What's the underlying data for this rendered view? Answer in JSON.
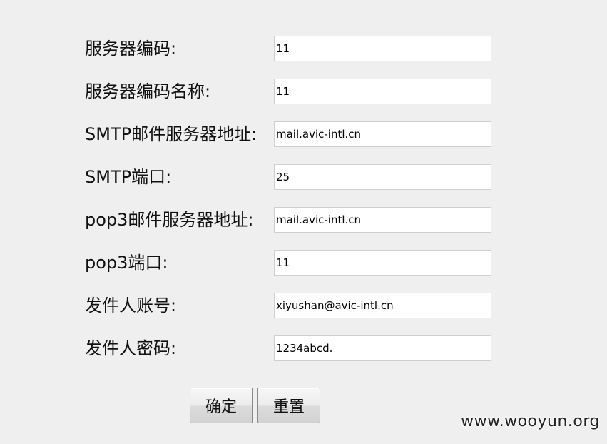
{
  "form": {
    "fields": [
      {
        "label": "服务器编码:",
        "value": "11"
      },
      {
        "label": "服务器编码名称:",
        "value": "11"
      },
      {
        "label": "SMTP邮件服务器地址:",
        "value": "mail.avic-intl.cn"
      },
      {
        "label": "SMTP端口:",
        "value": "25"
      },
      {
        "label": "pop3邮件服务器地址:",
        "value": "mail.avic-intl.cn"
      },
      {
        "label": "pop3端口:",
        "value": "11"
      },
      {
        "label": "发件人账号:",
        "value": "xiyushan@avic-intl.cn"
      },
      {
        "label": "发件人密码:",
        "value": "1234abcd."
      }
    ],
    "buttons": {
      "confirm_label": "确定",
      "reset_label": "重置"
    }
  },
  "watermark": "www.wooyun.org"
}
